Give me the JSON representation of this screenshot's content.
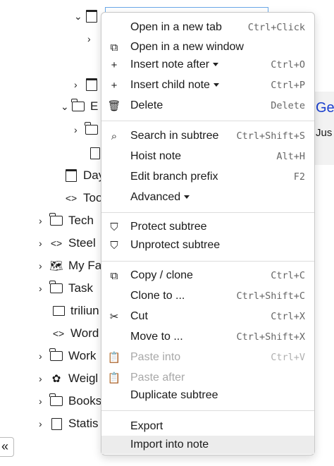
{
  "tree": {
    "items": [
      {
        "label": "Day"
      },
      {
        "label": "Too"
      },
      {
        "label": "Tech"
      },
      {
        "label": "Steel"
      },
      {
        "label": "My Fa"
      },
      {
        "label": "Task"
      },
      {
        "label": "triliun"
      },
      {
        "label": "Word"
      },
      {
        "label": "Work"
      },
      {
        "label": "Weigl"
      },
      {
        "label": "Books"
      },
      {
        "label": "Statis"
      }
    ],
    "partial_label": "E"
  },
  "right_panel": {
    "title": "Ge",
    "text": "Jus"
  },
  "context_menu": {
    "items": [
      {
        "label": "Open in a new tab",
        "shortcut": "Ctrl+Click",
        "icon": ""
      },
      {
        "label": "Open in a new window",
        "shortcut": "",
        "icon": "window-icon"
      },
      {
        "label": "Insert note after",
        "shortcut": "Ctrl+O",
        "icon": "plus-icon"
      },
      {
        "label": "Insert child note",
        "shortcut": "Ctrl+P",
        "icon": "plus-icon"
      },
      {
        "label": "Delete",
        "shortcut": "Delete",
        "icon": "trash-icon"
      },
      {
        "label": "Search in subtree",
        "shortcut": "Ctrl+Shift+S",
        "icon": "search-icon"
      },
      {
        "label": "Hoist note",
        "shortcut": "Alt+H",
        "icon": ""
      },
      {
        "label": "Edit branch prefix",
        "shortcut": "F2",
        "icon": ""
      },
      {
        "label": "Advanced",
        "shortcut": "",
        "icon": ""
      },
      {
        "label": "Protect subtree",
        "shortcut": "",
        "icon": "shield-check-icon"
      },
      {
        "label": "Unprotect subtree",
        "shortcut": "",
        "icon": "shield-icon"
      },
      {
        "label": "Copy / clone",
        "shortcut": "Ctrl+C",
        "icon": "copy-icon"
      },
      {
        "label": "Clone to ...",
        "shortcut": "Ctrl+Shift+C",
        "icon": ""
      },
      {
        "label": "Cut",
        "shortcut": "Ctrl+X",
        "icon": "scissors-icon"
      },
      {
        "label": "Move to ...",
        "shortcut": "Ctrl+Shift+X",
        "icon": ""
      },
      {
        "label": "Paste into",
        "shortcut": "Ctrl+V",
        "icon": "paste-icon"
      },
      {
        "label": "Paste after",
        "shortcut": "",
        "icon": "paste-icon"
      },
      {
        "label": "Duplicate subtree",
        "shortcut": "",
        "icon": ""
      },
      {
        "label": "Export",
        "shortcut": "",
        "icon": ""
      },
      {
        "label": "Import into note",
        "shortcut": "",
        "icon": ""
      }
    ]
  },
  "collapse_button": "«"
}
